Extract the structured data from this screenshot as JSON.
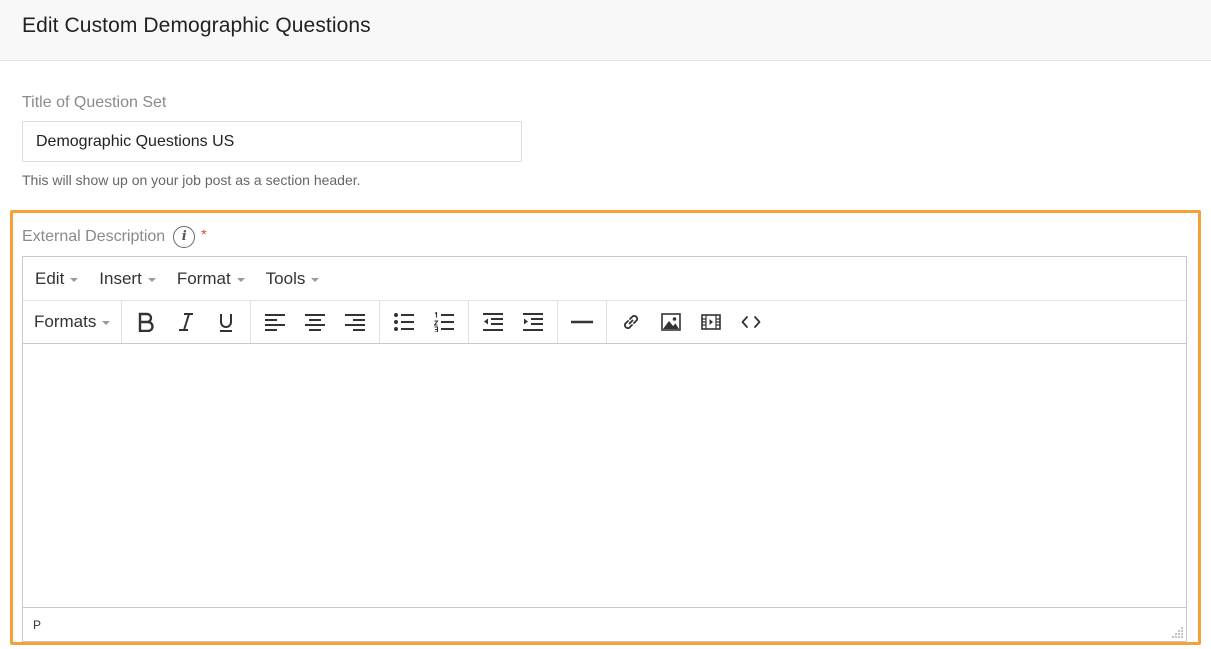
{
  "header": {
    "title": "Edit Custom Demographic Questions"
  },
  "title_field": {
    "label": "Title of Question Set",
    "value": "Demographic Questions US",
    "help": "This will show up on your job post as a section header."
  },
  "description_field": {
    "label": "External Description",
    "info_glyph": "i",
    "required_mark": "*"
  },
  "editor": {
    "menus": [
      "Edit",
      "Insert",
      "Format",
      "Tools"
    ],
    "formats_label": "Formats",
    "toolbar_icons": [
      "bold-icon",
      "italic-icon",
      "underline-icon",
      "align-left-icon",
      "align-center-icon",
      "align-right-icon",
      "bullet-list-icon",
      "numbered-list-icon",
      "outdent-icon",
      "indent-icon",
      "horizontal-rule-icon",
      "link-icon",
      "image-icon",
      "video-icon",
      "source-code-icon"
    ],
    "status_path": "P"
  },
  "colors": {
    "highlight": "#f5a138",
    "required": "#e23b3b"
  }
}
